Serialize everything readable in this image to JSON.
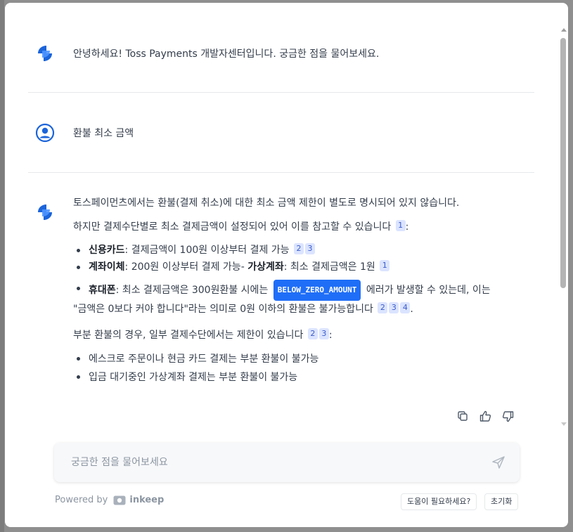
{
  "messages": {
    "greeting": "안녕하세요! Toss Payments 개발자센터입니다. 궁금한 점을 물어보세요.",
    "user_question": "환불 최소 금액"
  },
  "answer": {
    "p1": "토스페이먼츠에서는 환불(결제 취소)에 대한 최소 금액 제한이 별도로 명시되어 있지 않습니다.",
    "p2": "하지만 결제수단별로 최소 결제금액이 설정되어 있어 이를 참고할 수 있습니다",
    "p2_cite": "1",
    "bullet1_bold": "신용카드",
    "bullet1_text": ": 결제금액이 100원 이상부터 결제 가능",
    "bullet1_cites": [
      "2",
      "3"
    ],
    "bullet2_bold1": "계좌이체",
    "bullet2_text1": ": 200원 이상부터 결제 가능- ",
    "bullet2_bold2": "가상계좌",
    "bullet2_text2": ": 최소 결제금액은 1원",
    "bullet2_cite": "1",
    "bullet3_bold": "휴대폰",
    "bullet3_text1": ": 최소 결제금액은 300원환불 시에는",
    "bullet3_code": "BELOW_ZERO_AMOUNT",
    "bullet3_text2": "에러가 발생할 수 있는데, 이는",
    "bullet3_line2": "\"금액은 0보다 커야 합니다\"라는 의미로 0원 이하의 환불은 불가능합니다",
    "bullet3_cites": [
      "2",
      "3",
      "4"
    ],
    "p3": "부분 환불의 경우, 일부 결제수단에서는 제한이 있습니다",
    "p3_cites": [
      "2",
      "3"
    ],
    "partial_items": [
      "에스크로 주문이나 현금 카드 결제는 부분 환불이 불가능",
      "입금 대기중인 가상계좌 결제는 부분 환불이 불가능"
    ]
  },
  "actions": [
    "copy-icon",
    "thumbs-up-icon",
    "thumbs-down-icon"
  ],
  "input": {
    "placeholder": "궁금한 점을 물어보세요"
  },
  "footer": {
    "powered_by": "Powered by",
    "brand": "inkeep",
    "help_button": "도움이 필요하세요?",
    "reset_button": "초기화"
  },
  "colors": {
    "accent": "#1f6ef7",
    "bot_blue": "#1b64da",
    "cite_bg": "#dbe4ff"
  }
}
